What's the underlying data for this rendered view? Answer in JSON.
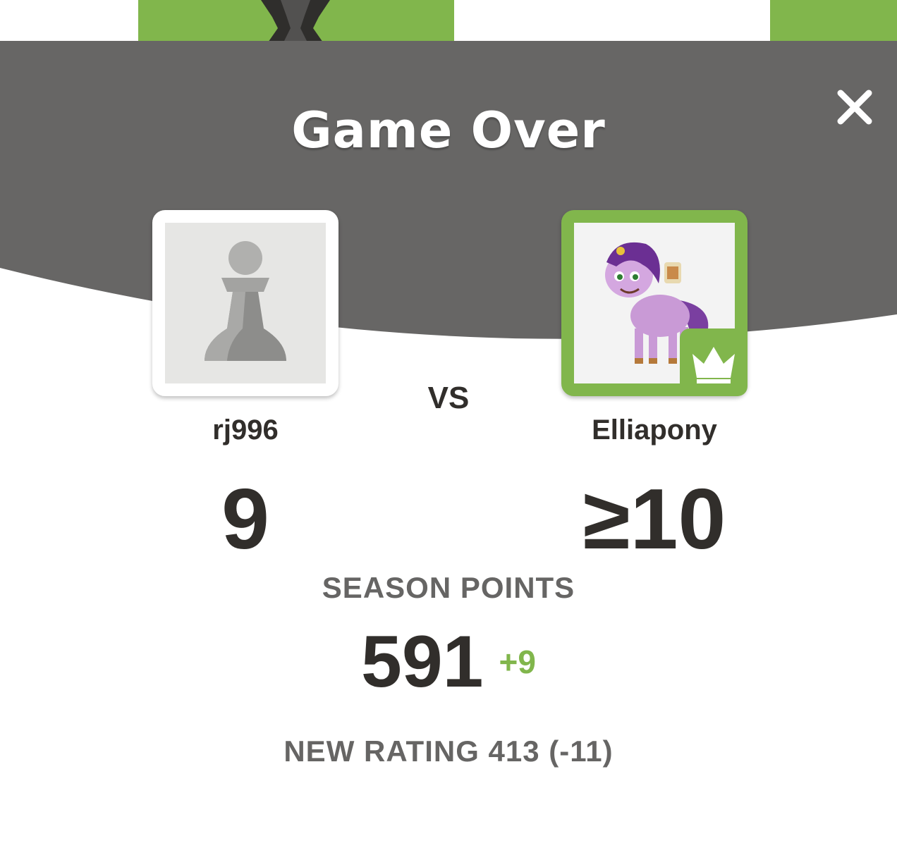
{
  "colors": {
    "board_light": "#ebecd0",
    "board_dark": "#81b64c",
    "header_bg": "#676665",
    "accent_green": "#81b64c",
    "text_dark": "#312e2b",
    "text_muted": "#666564"
  },
  "modal": {
    "title": "Game Over",
    "close_icon": "close-icon"
  },
  "players": {
    "left": {
      "username": "rj996",
      "avatar_icon": "pawn-icon",
      "score": "9"
    },
    "right": {
      "username": "Elliapony",
      "avatar_icon": "pony-avatar",
      "badge_icon": "crown-icon",
      "score": "≥10"
    }
  },
  "vs_label": "VS",
  "season": {
    "label": "SEASON POINTS",
    "value": "591",
    "delta": "+9"
  },
  "rating": {
    "text": "NEW RATING 413 (-11)"
  }
}
